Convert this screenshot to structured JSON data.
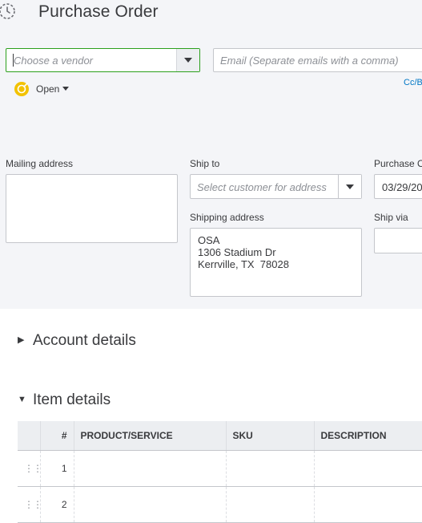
{
  "header": {
    "title": "Purchase Order",
    "history_icon": "history-clock-icon"
  },
  "vendor": {
    "placeholder": "Choose a vendor"
  },
  "email": {
    "placeholder": "Email (Separate emails with a comma)"
  },
  "cc_link": "Cc/B",
  "status": {
    "label": "Open",
    "icon": "status-tag-icon"
  },
  "mailing_address": {
    "label": "Mailing address",
    "value": ""
  },
  "ship_to": {
    "label": "Ship to",
    "placeholder": "Select customer for address"
  },
  "shipping_address": {
    "label": "Shipping address",
    "lines": [
      "OSA",
      "1306 Stadium Dr",
      "Kerrville, TX  78028"
    ]
  },
  "purchase_order_date": {
    "label": "Purchase O",
    "value": "03/29/20"
  },
  "ship_via": {
    "label": "Ship via",
    "value": ""
  },
  "sections": {
    "account_details": "Account details",
    "item_details": "Item details"
  },
  "items_table": {
    "columns": [
      "",
      "#",
      "PRODUCT/SERVICE",
      "SKU",
      "DESCRIPTION"
    ],
    "rows": [
      {
        "num": "1",
        "product": "",
        "sku": "",
        "description": ""
      },
      {
        "num": "2",
        "product": "",
        "sku": "",
        "description": ""
      }
    ]
  },
  "colors": {
    "accent_green": "#2ca01c",
    "link_blue": "#0077c5",
    "status_yellow": "#f2c200",
    "panel_bg": "#f4f5f8"
  }
}
